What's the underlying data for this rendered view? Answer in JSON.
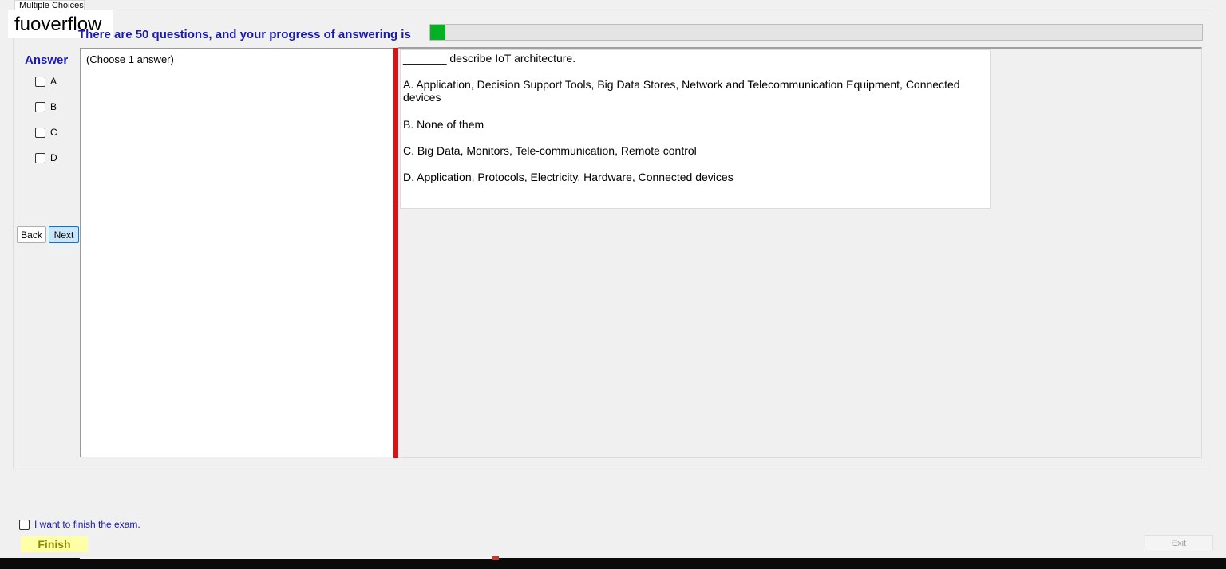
{
  "tab": {
    "label": "Multiple Choices"
  },
  "watermark": {
    "text": "fuoverflow"
  },
  "progress": {
    "label": "There are 50 questions, and your progress of answering is",
    "fraction": 0.02,
    "fill_color": "#06b025"
  },
  "answer": {
    "heading": "Answer",
    "options": [
      {
        "label": "A",
        "checked": false
      },
      {
        "label": "B",
        "checked": false
      },
      {
        "label": "C",
        "checked": false
      },
      {
        "label": "D",
        "checked": false
      }
    ]
  },
  "nav": {
    "back_label": "Back",
    "next_label": "Next"
  },
  "left_pane": {
    "choose_label": "(Choose 1 answer)"
  },
  "question": {
    "text": "_______ describe IoT architecture.",
    "options": [
      "A.  Application, Decision Support Tools, Big Data Stores, Network and Telecommunication Equipment, Connected devices",
      "B.  None of them",
      "C.  Big Data, Monitors, Tele-communication, Remote control",
      "D.  Application, Protocols, Electricity, Hardware, Connected devices"
    ]
  },
  "finish": {
    "checkbox_label": "I want to finish the exam.",
    "button_label": "Finish"
  },
  "exit": {
    "label": "Exit"
  },
  "colors": {
    "accent_blue": "#1a1ab0",
    "splitter_red": "#d4161b",
    "finish_bg": "#ffffa8"
  }
}
